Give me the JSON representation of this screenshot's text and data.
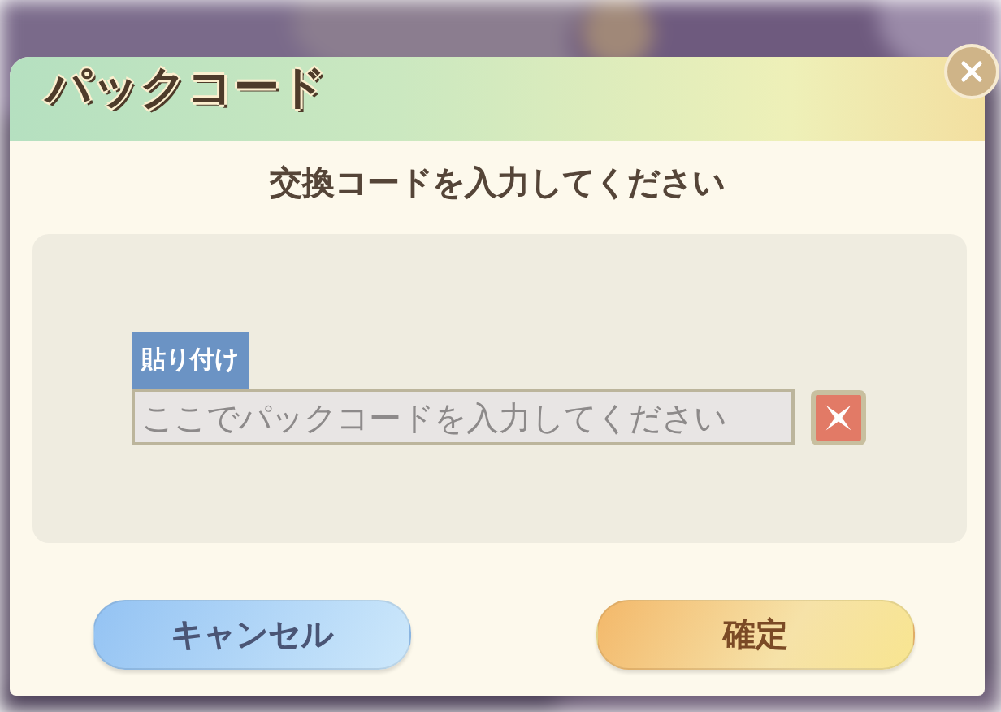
{
  "dialog": {
    "title": "パックコード",
    "prompt": "交換コードを入力してください",
    "paste_button": "貼り付け",
    "code_field": {
      "placeholder": "ここでパックコードを入力してください"
    },
    "buttons": [
      {
        "label": "キャンセル",
        "kind": "cancel"
      },
      {
        "label": "確定",
        "kind": "confirm"
      }
    ]
  }
}
